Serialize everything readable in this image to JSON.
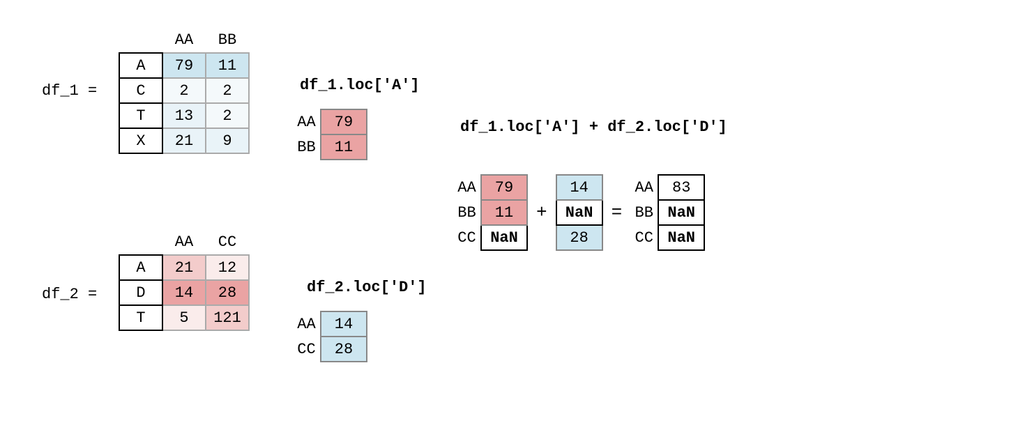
{
  "df1": {
    "name": "df_1 =",
    "cols": [
      "AA",
      "BB"
    ],
    "rows": [
      {
        "idx": "A",
        "vals": [
          "79",
          "11"
        ]
      },
      {
        "idx": "C",
        "vals": [
          "2",
          "2"
        ]
      },
      {
        "idx": "T",
        "vals": [
          "13",
          "2"
        ]
      },
      {
        "idx": "X",
        "vals": [
          "21",
          "9"
        ]
      }
    ]
  },
  "df2": {
    "name": "df_2 =",
    "cols": [
      "AA",
      "CC"
    ],
    "rows": [
      {
        "idx": "A",
        "vals": [
          "21",
          "12"
        ]
      },
      {
        "idx": "D",
        "vals": [
          "14",
          "28"
        ]
      },
      {
        "idx": "T",
        "vals": [
          "5",
          "121"
        ]
      }
    ]
  },
  "locA": {
    "label": "df_1.loc['A']",
    "rows": [
      {
        "lbl": "AA",
        "val": "79"
      },
      {
        "lbl": "BB",
        "val": "11"
      }
    ]
  },
  "locD": {
    "label": "df_2.loc['D']",
    "rows": [
      {
        "lbl": "AA",
        "val": "14"
      },
      {
        "lbl": "CC",
        "val": "28"
      }
    ]
  },
  "sum": {
    "label": "df_1.loc['A'] + df_2.loc['D']",
    "left": {
      "rows": [
        {
          "lbl": "AA",
          "val": "79"
        },
        {
          "lbl": "BB",
          "val": "11"
        },
        {
          "lbl": "CC",
          "val": "NaN"
        }
      ]
    },
    "plus": "+",
    "right": {
      "rows": [
        {
          "val": "14"
        },
        {
          "val": "NaN"
        },
        {
          "val": "28"
        }
      ]
    },
    "equals": "=",
    "result": {
      "rows": [
        {
          "lbl": "AA",
          "val": "83"
        },
        {
          "lbl": "BB",
          "val": "NaN"
        },
        {
          "lbl": "CC",
          "val": "NaN"
        }
      ]
    }
  }
}
